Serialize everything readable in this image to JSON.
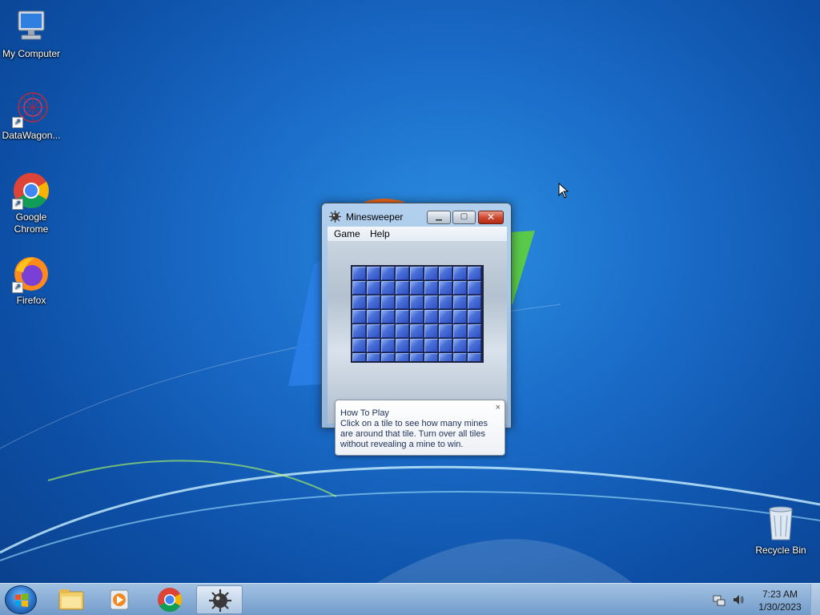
{
  "desktop": {
    "icons": [
      {
        "label": "My Computer",
        "icon": "computer-icon"
      },
      {
        "label": "DataWagon...",
        "icon": "datawagon-icon"
      },
      {
        "label": "Google Chrome",
        "icon": "chrome-icon"
      },
      {
        "label": "Firefox",
        "icon": "firefox-icon"
      },
      {
        "label": "Recycle Bin",
        "icon": "recycle-bin-icon"
      }
    ]
  },
  "window": {
    "title": "Minesweeper",
    "menu": [
      "Game",
      "Help"
    ],
    "buttons": {
      "minimize": "minimize",
      "maximize": "maximize",
      "close": "close"
    },
    "board": {
      "columns": 9,
      "visible_rows": 7
    },
    "tooltip": {
      "title": "How To Play",
      "body": "Click on a tile to see how many mines are around that tile. Turn over all tiles without revealing a mine to win.",
      "close": "×"
    }
  },
  "taskbar": {
    "items": [
      {
        "icon": "windows-start-icon"
      },
      {
        "icon": "file-explorer-icon"
      },
      {
        "icon": "media-player-icon"
      },
      {
        "icon": "chrome-icon"
      },
      {
        "icon": "minesweeper-icon",
        "active": true
      }
    ],
    "tray": {
      "icons": [
        "network-icon",
        "volume-icon"
      ]
    },
    "clock": {
      "time": "7:23 AM",
      "date": "1/30/2023"
    }
  },
  "colors": {
    "desktop_blue": "#1a6cc8",
    "tile_blue": "#3f63d0",
    "close_red": "#cf4a32"
  }
}
